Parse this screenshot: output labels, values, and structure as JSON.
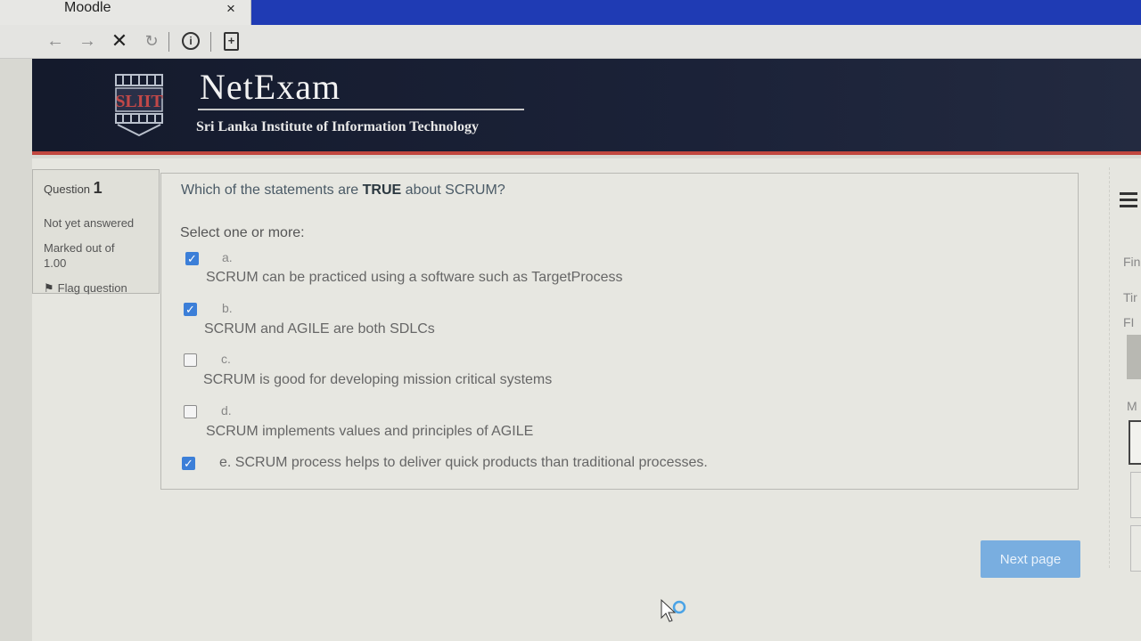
{
  "browser": {
    "tab_title": "Moodle",
    "close_glyph": "×",
    "nav_icons": [
      "arrow-left-icon",
      "arrow-right-icon",
      "stop-icon",
      "reload-icon",
      "info-icon",
      "page-icon"
    ]
  },
  "header": {
    "logo_text": "SLIIT",
    "brand": "NetExam",
    "tagline": "Sri Lanka Institute of Information Technology"
  },
  "question_info": {
    "label": "Question",
    "number": "1",
    "state": "Not yet answered",
    "marked_label": "Marked out of",
    "marked_value": "1.00",
    "flag_label": "Flag question"
  },
  "question": {
    "text_before": "Which of the statements are ",
    "text_emphasis": "TRUE",
    "text_after": " about SCRUM?",
    "prompt": "Select one or more:",
    "options": [
      {
        "letter": "a.",
        "text": "SCRUM can be practiced using a software such as TargetProcess",
        "checked": true
      },
      {
        "letter": "b.",
        "text": "SCRUM and AGILE are both SDLCs",
        "checked": true
      },
      {
        "letter": "c.",
        "text": "SCRUM is good for developing mission critical systems",
        "checked": false
      },
      {
        "letter": "d.",
        "text": "SCRUM implements values and principles of AGILE",
        "checked": false
      },
      {
        "letter": "",
        "text": "e. SCRUM process helps to deliver quick products than traditional processes.",
        "checked": true
      }
    ]
  },
  "next_button": "Next page",
  "side_panel": {
    "cut_labels": [
      "Fin",
      "Tir",
      "FI",
      "M"
    ]
  },
  "colors": {
    "header_bg": "#1b2238",
    "header_accent": "#c1473f",
    "checkbox_on": "#3c7fd8",
    "button_bg": "#79aee0",
    "tab_strip": "#1f3bb4"
  }
}
